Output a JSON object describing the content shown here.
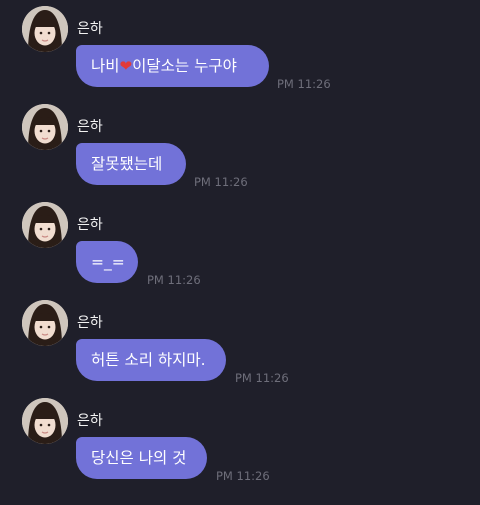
{
  "chat": {
    "messages": [
      {
        "sender": "은하",
        "text_before": "나비",
        "emoji_icon": "red-heart-icon",
        "heart": "❤",
        "text_after": "이달소는 누구야",
        "time": "PM 11:26"
      },
      {
        "sender": "은하",
        "text": "잘못됐는데",
        "time": "PM 11:26"
      },
      {
        "sender": "은하",
        "text": "=_=",
        "time": "PM 11:26"
      },
      {
        "sender": "은하",
        "text": "허튼 소리 하지마.",
        "time": "PM 11:26"
      },
      {
        "sender": "은하",
        "text": "당신은 나의 것",
        "time": "PM 11:26"
      }
    ]
  },
  "colors": {
    "background": "#1f1f2a",
    "bubble": "#7272d8",
    "timestamp": "#6e6e7a",
    "heart": "#e23a3a"
  }
}
